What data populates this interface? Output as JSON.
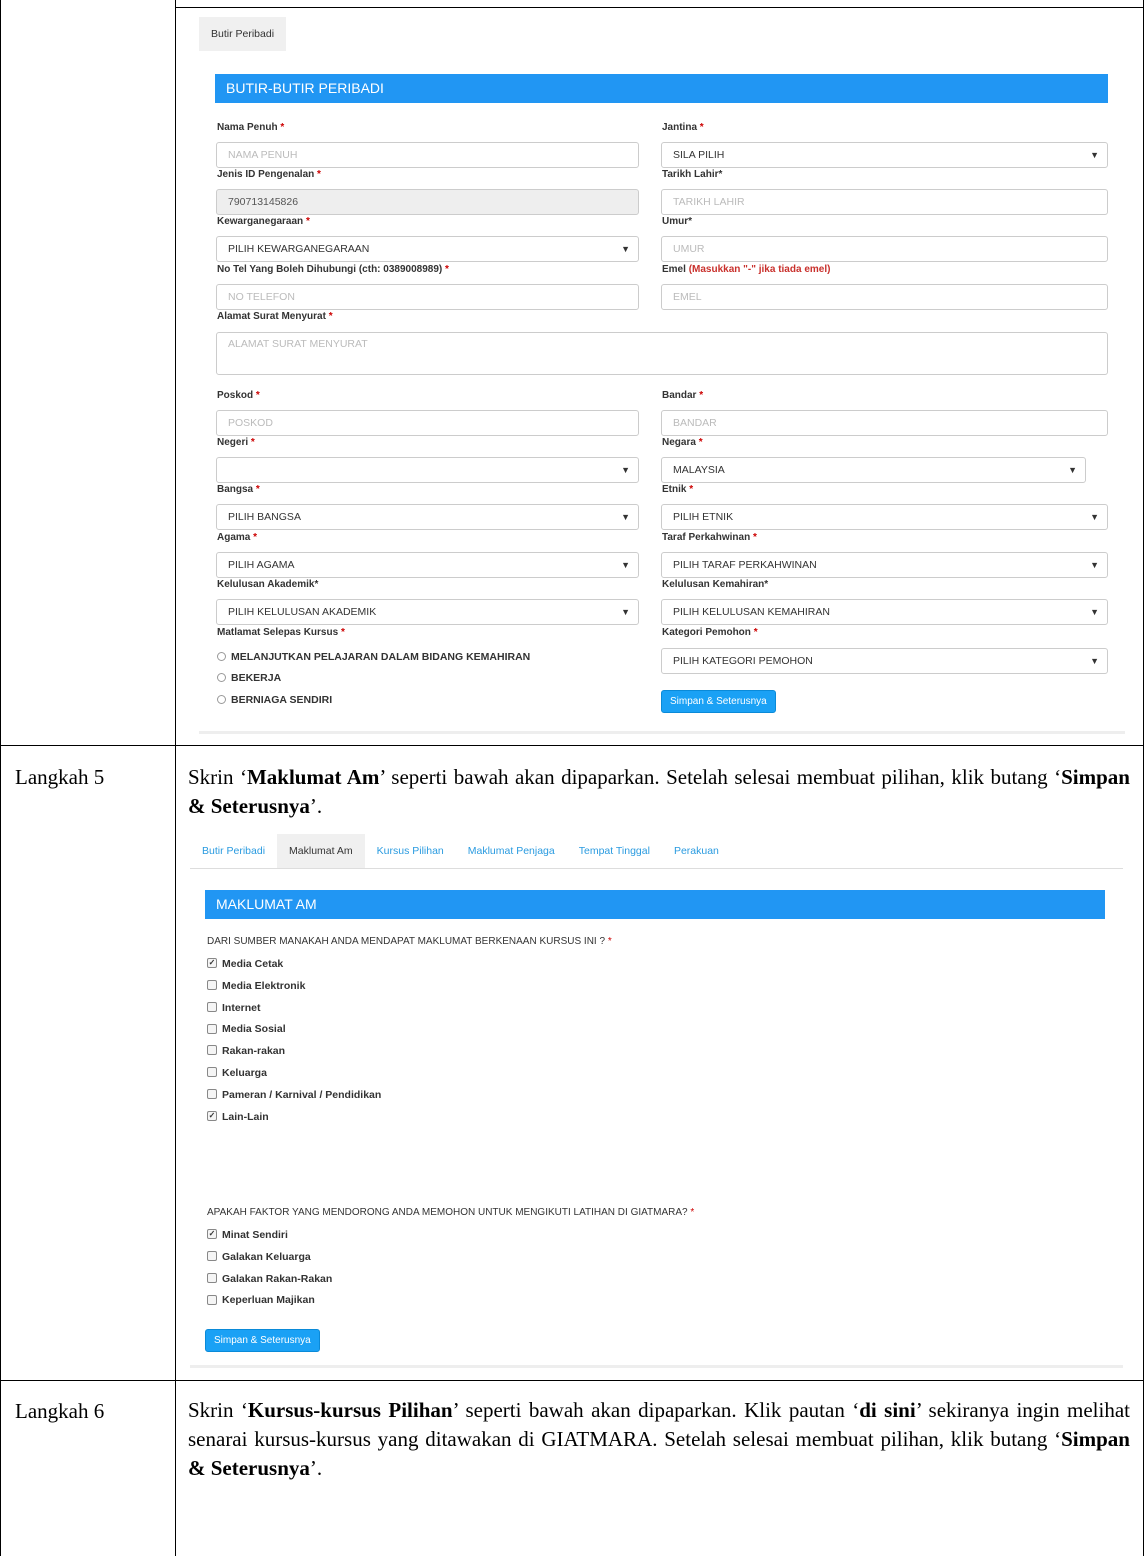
{
  "screen1": {
    "tabs": [
      "Butir Peribadi"
    ],
    "section_title": "BUTIR-BUTIR PERIBADI",
    "fields": {
      "nama_label": "Nama Penuh",
      "nama_placeholder": "NAMA PENUH",
      "jantina_label": "Jantina",
      "jantina_value": "SILA PILIH",
      "jenis_id_label": "Jenis ID Pengenalan",
      "jenis_id_value": "790713145826",
      "tarikh_label": "Tarikh Lahir*",
      "tarikh_placeholder": "TARIKH LAHIR",
      "kewarganegaraan_label": "Kewarganegaraan",
      "kewarganegaraan_value": "PILIH KEWARGANEGARAAN",
      "umur_label": "Umur*",
      "umur_placeholder": "UMUR",
      "tel_label": "No Tel Yang Boleh Dihubungi (cth: 0389008989)",
      "tel_placeholder": "NO TELEFON",
      "emel_label": "Emel",
      "emel_note": "(Masukkan \"-\" jika tiada emel)",
      "emel_placeholder": "EMEL",
      "alamat_label": "Alamat Surat Menyurat",
      "alamat_placeholder": "ALAMAT SURAT MENYURAT",
      "poskod_label": "Poskod",
      "poskod_placeholder": "POSKOD",
      "bandar_label": "Bandar",
      "bandar_placeholder": "BANDAR",
      "negeri_label": "Negeri",
      "negeri_value": "",
      "negara_label": "Negara",
      "negara_value": "MALAYSIA",
      "bangsa_label": "Bangsa",
      "bangsa_value": "PILIH BANGSA",
      "etnik_label": "Etnik",
      "etnik_value": "PILIH ETNIK",
      "agama_label": "Agama",
      "agama_value": "PILIH AGAMA",
      "taraf_label": "Taraf Perkahwinan",
      "taraf_value": "PILIH TARAF PERKAHWINAN",
      "akademik_label": "Kelulusan Akademik*",
      "akademik_value": "PILIH KELULUSAN AKADEMIK",
      "kemahiran_label": "Kelulusan Kemahiran*",
      "kemahiran_value": "PILIH KELULUSAN KEMAHIRAN",
      "matlamat_label": "Matlamat Selepas Kursus",
      "matlamat_options": [
        "MELANJUTKAN PELAJARAN DALAM BIDANG KEMAHIRAN",
        "BEKERJA",
        "BERNIAGA SENDIRI"
      ],
      "kategori_label": "Kategori Pemohon",
      "kategori_value": "PILIH KATEGORI PEMOHON"
    },
    "submit_label": "Simpan & Seterusnya"
  },
  "step5": {
    "label": "Langkah 5",
    "text_pre": "Skrin ‘",
    "text_bold1": "Maklumat Am",
    "text_mid": "’ seperti bawah akan dipaparkan. Setelah selesai membuat pilihan, klik butang ‘",
    "text_bold2": "Simpan & Seterusnya",
    "text_post": "’."
  },
  "screen2": {
    "tabs": [
      "Butir Peribadi",
      "Maklumat Am",
      "Kursus Pilihan",
      "Maklumat Penjaga",
      "Tempat Tinggal",
      "Perakuan"
    ],
    "active_tab": 1,
    "section_title": "MAKLUMAT AM",
    "q1": "DARI SUMBER MANAKAH ANDA MENDAPAT MAKLUMAT BERKENAAN KURSUS INI ?",
    "q1_options": [
      {
        "label": "Media Cetak",
        "checked": true
      },
      {
        "label": "Media Elektronik",
        "checked": false
      },
      {
        "label": "Internet",
        "checked": false
      },
      {
        "label": "Media Sosial",
        "checked": false
      },
      {
        "label": "Rakan-rakan",
        "checked": false
      },
      {
        "label": "Keluarga",
        "checked": false
      },
      {
        "label": "Pameran / Karnival / Pendidikan",
        "checked": false
      },
      {
        "label": "Lain-Lain",
        "checked": true
      }
    ],
    "q2": "APAKAH FAKTOR YANG MENDORONG ANDA MEMOHON UNTUK MENGIKUTI LATIHAN DI GIATMARA?",
    "q2_options": [
      {
        "label": "Minat Sendiri",
        "checked": true
      },
      {
        "label": "Galakan Keluarga",
        "checked": false
      },
      {
        "label": "Galakan Rakan-Rakan",
        "checked": false
      },
      {
        "label": "Keperluan Majikan",
        "checked": false
      }
    ],
    "submit_label": "Simpan & Seterusnya"
  },
  "step6": {
    "label": "Langkah 6",
    "t1": "Skrin ‘",
    "b1": "Kursus-kursus Pilihan",
    "t2": "’ seperti bawah akan dipaparkan. Klik pautan ‘",
    "b2": "di sini",
    "t3": "’ sekiranya ingin melihat senarai kursus-kursus yang ditawakan di GIATMARA. Setelah selesai membuat pilihan, klik butang ‘",
    "b3": "Simpan & Seterusnya",
    "t4": "’."
  }
}
